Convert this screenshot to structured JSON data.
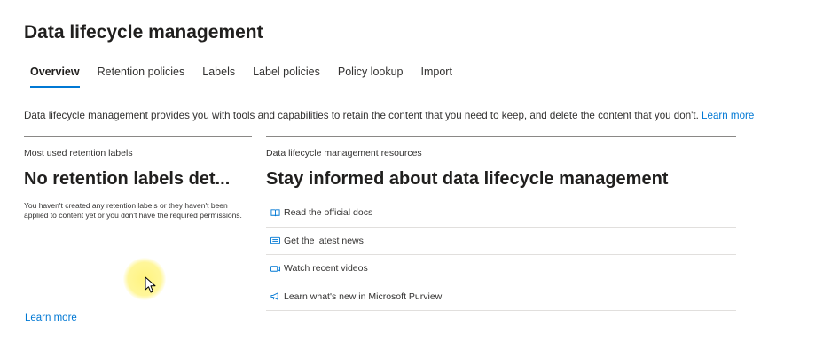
{
  "header": {
    "title": "Data lifecycle management"
  },
  "tabs": [
    {
      "label": "Overview",
      "active": true
    },
    {
      "label": "Retention policies",
      "active": false
    },
    {
      "label": "Labels",
      "active": false
    },
    {
      "label": "Label policies",
      "active": false
    },
    {
      "label": "Policy lookup",
      "active": false
    },
    {
      "label": "Import",
      "active": false
    }
  ],
  "description": {
    "text": "Data lifecycle management provides you with tools and capabilities to retain the content that you need to keep, and delete the content that you don't.",
    "link": "Learn more"
  },
  "retention_card": {
    "label": "Most used retention labels",
    "heading": "No retention labels det...",
    "body": "You haven't created any retention labels or they haven't been applied to content yet or you don't have the required permissions.",
    "learn_more": "Learn more"
  },
  "resources_card": {
    "label": "Data lifecycle management resources",
    "heading": "Stay informed about data lifecycle management",
    "items": [
      {
        "label": "Read the official docs",
        "icon": "book-icon"
      },
      {
        "label": "Get the latest news",
        "icon": "news-icon"
      },
      {
        "label": "Watch recent videos",
        "icon": "video-icon"
      },
      {
        "label": "Learn what's new in Microsoft Purview",
        "icon": "megaphone-icon"
      }
    ]
  },
  "colors": {
    "accent": "#0078d4",
    "text": "#323130",
    "heading": "#201f1e",
    "highlight": "#fff378"
  }
}
